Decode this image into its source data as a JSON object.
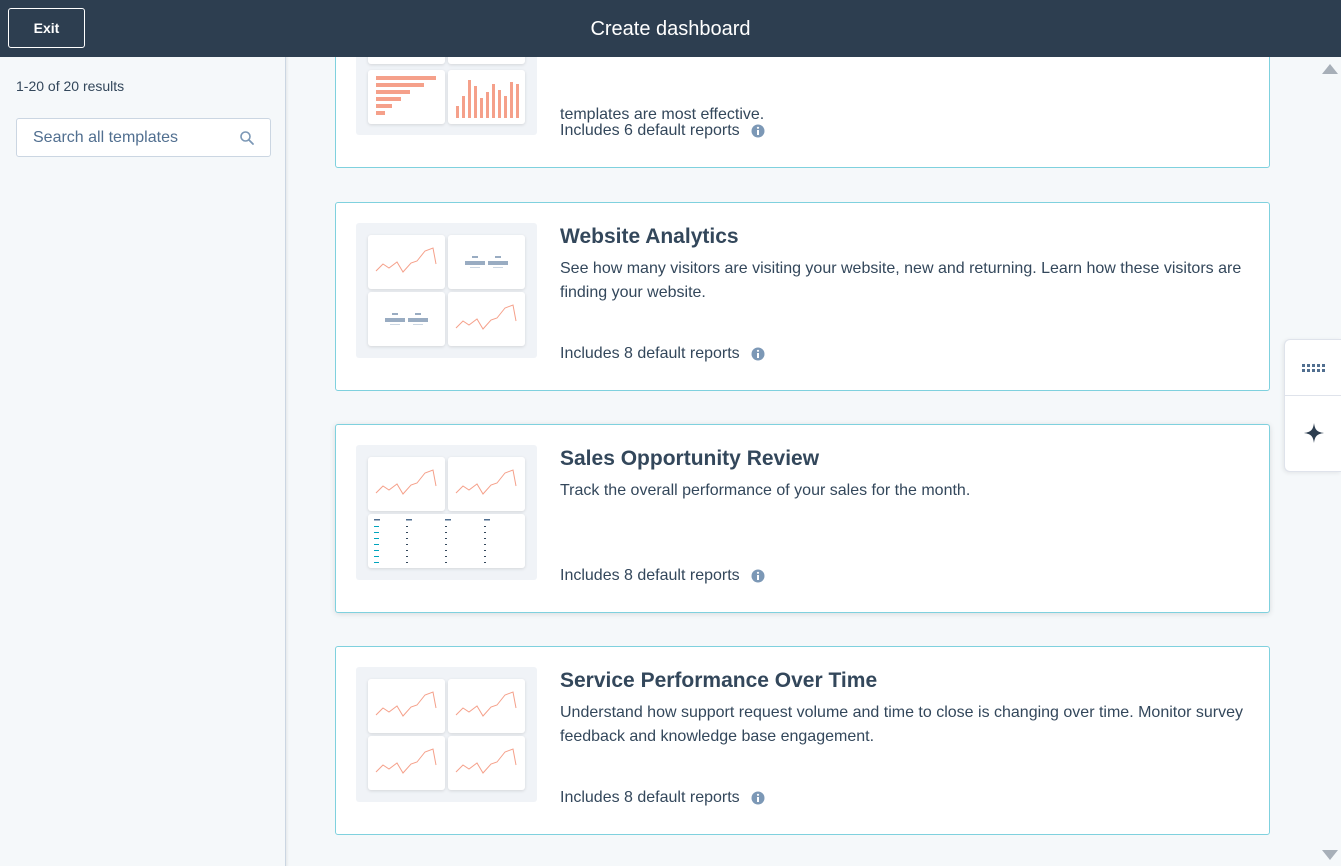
{
  "header": {
    "exit_label": "Exit",
    "title": "Create dashboard"
  },
  "sidebar": {
    "results_text": "1-20 of 20 results",
    "search_placeholder": "Search all templates"
  },
  "cards": [
    {
      "title": "",
      "description": "templates are most effective.",
      "reports": "Includes 6 default reports"
    },
    {
      "title": "Website Analytics",
      "description": "See how many visitors are visiting your website, new and returning. Learn how these visitors are finding your website.",
      "reports": "Includes 8 default reports"
    },
    {
      "title": "Sales Opportunity Review",
      "description": "Track the overall performance of your sales for the month.",
      "reports": "Includes 8 default reports"
    },
    {
      "title": "Service Performance Over Time",
      "description": "Understand how support request volume and time to close is changing over time. Monitor survey feedback and knowledge base engagement.",
      "reports": "Includes 8 default reports"
    }
  ],
  "icons": {
    "search": "search-icon",
    "info": "info-icon",
    "grid": "grid-dots-icon",
    "ai": "sparkle-icon"
  },
  "colors": {
    "header_bg": "#2d3e50",
    "card_border": "#7fd1de",
    "chart_accent": "#f5a08a",
    "text": "#33475b"
  }
}
